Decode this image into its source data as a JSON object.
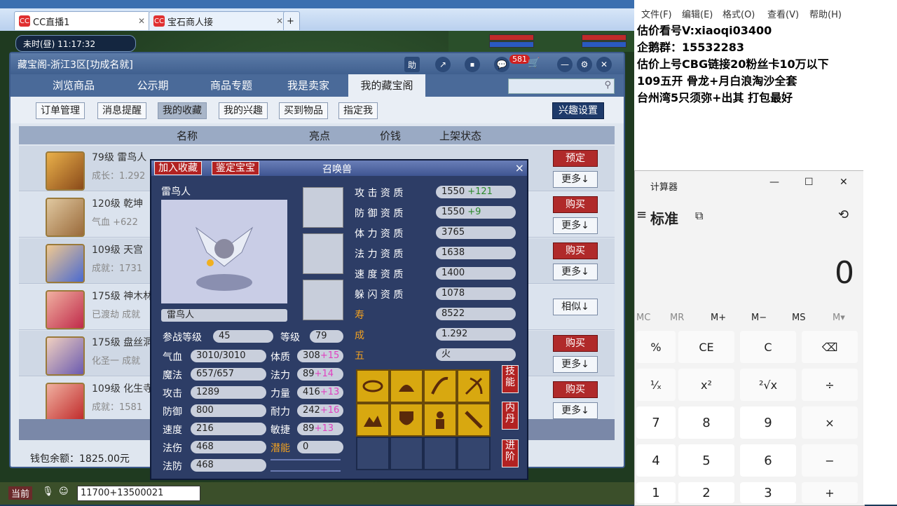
{
  "browser": {
    "tabs": [
      {
        "label": "CC直播1",
        "icon": "CC"
      },
      {
        "label": "宝石商人接",
        "icon": "CC"
      }
    ],
    "new_tab": "+"
  },
  "hud": {
    "time": "未时(昼)  11:17:32"
  },
  "cbg": {
    "title": "藏宝阁-浙江3区[功成名就]",
    "title_icons": [
      "助",
      "↗",
      "⏹",
      "💬"
    ],
    "badge": "581",
    "nav": [
      "浏览商品",
      "公示期",
      "商品专题",
      "我是卖家",
      "我的藏宝阁"
    ],
    "sub": [
      "订单管理",
      "消息提醒",
      "我的收藏",
      "我的兴趣",
      "买到物品",
      "指定我"
    ],
    "interest_button": "兴趣设置",
    "headers": [
      "名称",
      "亮点",
      "价钱",
      "上架状态"
    ],
    "rows": [
      {
        "title": "79级 雷鸟人",
        "sub": "成长：1.292",
        "action": "预定",
        "more": "更多↓"
      },
      {
        "title": "120级 乾坤",
        "sub": "气血 +622",
        "action": "购买",
        "more": "更多↓"
      },
      {
        "title": "109级 天宫",
        "sub": "成就：1731",
        "action": "购买",
        "more": "更多↓"
      },
      {
        "title": "175级 神木林",
        "sub": "已渡劫 成就",
        "action": "相似↓",
        "more": ""
      },
      {
        "title": "175级 盘丝洞",
        "sub": "化圣一 成就",
        "action": "购买",
        "more": "更多↓"
      },
      {
        "title": "109级 化生寺",
        "sub": "成就：1581",
        "action": "购买",
        "more": "更多↓"
      }
    ],
    "wallet": "钱包余额：1825.00元"
  },
  "pet": {
    "buttons": {
      "collect": "加入收藏",
      "appraise": "鉴定宝宝"
    },
    "title": "召唤兽",
    "close": "×",
    "name_label": "雷鸟人",
    "name_field": "雷鸟人",
    "join_level_label": "参战等级",
    "join_level": "45",
    "level_label": "等级",
    "level": "79",
    "stats_left": [
      {
        "label": "气血",
        "value": "3010/3010"
      },
      {
        "label": "魔法",
        "value": "657/657"
      },
      {
        "label": "攻击",
        "value": "1289"
      },
      {
        "label": "防御",
        "value": "800"
      },
      {
        "label": "速度",
        "value": "216"
      },
      {
        "label": "法伤",
        "value": "468"
      },
      {
        "label": "法防",
        "value": "468"
      }
    ],
    "stats_mid": [
      {
        "label": "体质",
        "base": "308",
        "bonus": "+15"
      },
      {
        "label": "法力",
        "base": "89",
        "bonus": "+14"
      },
      {
        "label": "力量",
        "base": "416",
        "bonus": "+13"
      },
      {
        "label": "耐力",
        "base": "242",
        "bonus": "+16"
      },
      {
        "label": "敏捷",
        "base": "89",
        "bonus": "+13"
      },
      {
        "label": "潜能",
        "base": "0",
        "bonus": ""
      }
    ],
    "aptitudes": [
      {
        "label": "攻 击 资 质",
        "base": "1550",
        "bonus": "+121"
      },
      {
        "label": "防 御 资 质",
        "base": "1550",
        "bonus": "+9"
      },
      {
        "label": "体 力 资 质",
        "base": "3765",
        "bonus": ""
      },
      {
        "label": "法 力 资 质",
        "base": "1638",
        "bonus": ""
      },
      {
        "label": "速 度 资 质",
        "base": "1400",
        "bonus": ""
      },
      {
        "label": "躲 闪 资 质",
        "base": "1078",
        "bonus": ""
      }
    ],
    "life": {
      "label": "寿 命",
      "value": "8522"
    },
    "growth": {
      "label": "成 长",
      "value": "1.292"
    },
    "element": {
      "label": "五 行",
      "value": "火"
    },
    "side_tabs": [
      "技能",
      "内丹",
      "进阶"
    ]
  },
  "chat": {
    "channel": "当前",
    "input": "11700+13500021"
  },
  "notepad": {
    "menu": [
      "文件(F)",
      "编辑(E)",
      "格式(O)",
      "查看(V)",
      "帮助(H)"
    ],
    "lines": [
      "估价看号V:xiaoqi03400",
      "企鹅群：15532283",
      "估价上号CBG链接20粉丝卡10万以下",
      "109五开 骨龙+月白浪淘沙全套",
      "台州湾5只须弥+出其 打包最好"
    ]
  },
  "calculator": {
    "title": "计算器",
    "mode": "标准",
    "display": "0",
    "memory": [
      "MC",
      "MR",
      "M+",
      "M−",
      "MS",
      "M▾"
    ],
    "keys": [
      "%",
      "CE",
      "C",
      "⌫",
      "¹⁄ₓ",
      "x²",
      "²√x",
      "÷",
      "7",
      "8",
      "9",
      "×",
      "4",
      "5",
      "6",
      "−",
      "1",
      "2",
      "3",
      "+"
    ]
  }
}
